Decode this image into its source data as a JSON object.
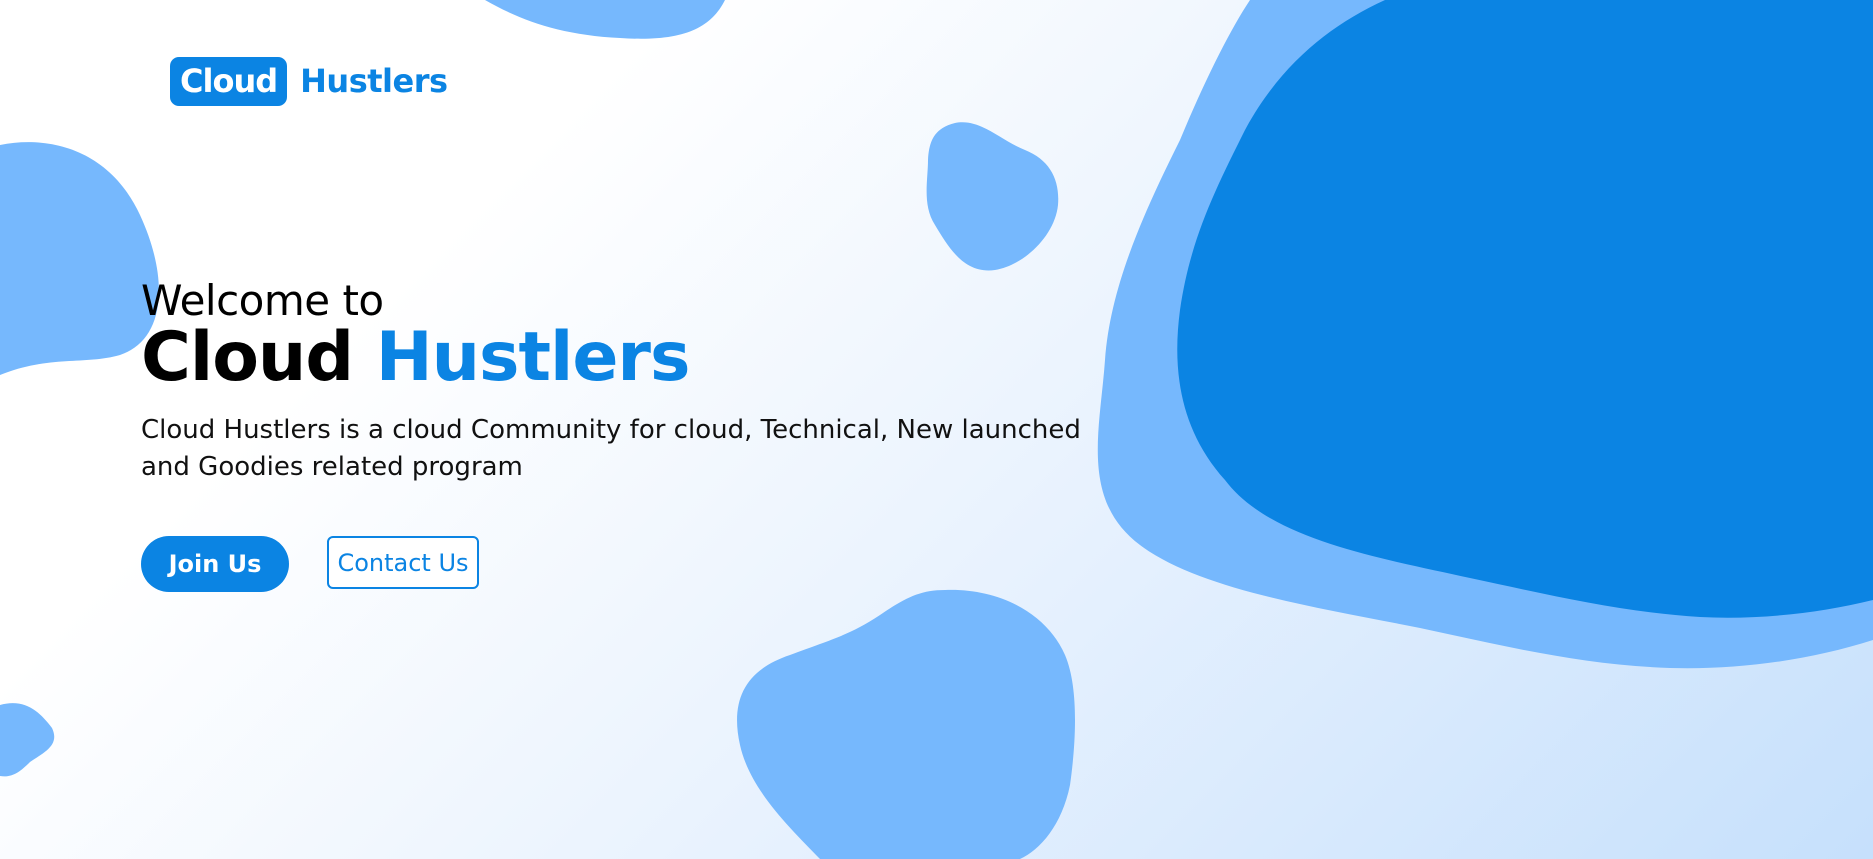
{
  "logo": {
    "box_text": "Cloud",
    "text": "Hustlers"
  },
  "hero": {
    "welcome": "Welcome to",
    "title_part1": "Cloud",
    "title_part2": "Hustlers",
    "description": "Cloud Hustlers is a cloud Community for cloud, Technical, New launched and Goodies related program"
  },
  "buttons": {
    "join": "Join Us",
    "contact": "Contact Us"
  },
  "colors": {
    "primary": "#0b84e3",
    "blob_light": "#76b8fd",
    "text": "#000000"
  }
}
